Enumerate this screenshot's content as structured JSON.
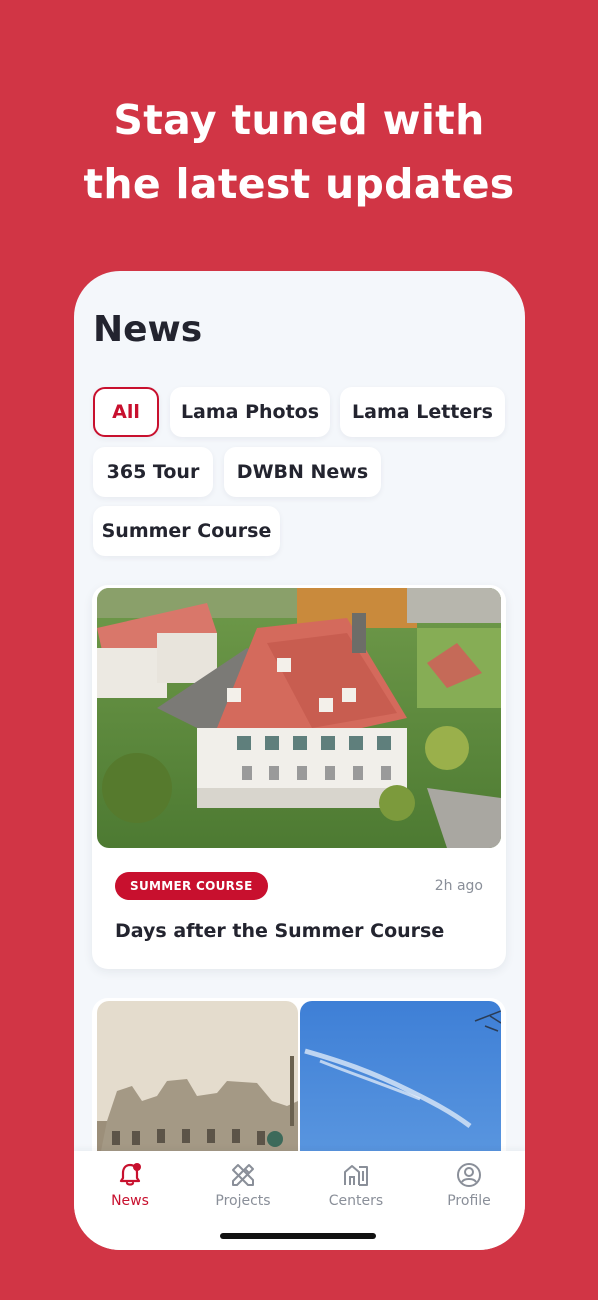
{
  "headline": {
    "line1": "Stay tuned with",
    "line2": "the latest updates"
  },
  "page": {
    "title": "News"
  },
  "filters": [
    {
      "label": "All",
      "active": true
    },
    {
      "label": "Lama Photos",
      "active": false
    },
    {
      "label": "Lama Letters",
      "active": false
    },
    {
      "label": "365 Tour",
      "active": false
    },
    {
      "label": "DWBN News",
      "active": false
    },
    {
      "label": "Summer Course",
      "active": false
    }
  ],
  "featured": {
    "category": "SUMMER COURSE",
    "time": "2h ago",
    "title": "Days after the Summer Course"
  },
  "tabs": [
    {
      "label": "News",
      "icon": "bell-icon",
      "active": true
    },
    {
      "label": "Projects",
      "icon": "tools-icon",
      "active": false
    },
    {
      "label": "Centers",
      "icon": "buildings-icon",
      "active": false
    },
    {
      "label": "Profile",
      "icon": "user-circle-icon",
      "active": false
    }
  ],
  "colors": {
    "brand": "#c8102e",
    "background": "#d13545",
    "text": "#23242f"
  }
}
